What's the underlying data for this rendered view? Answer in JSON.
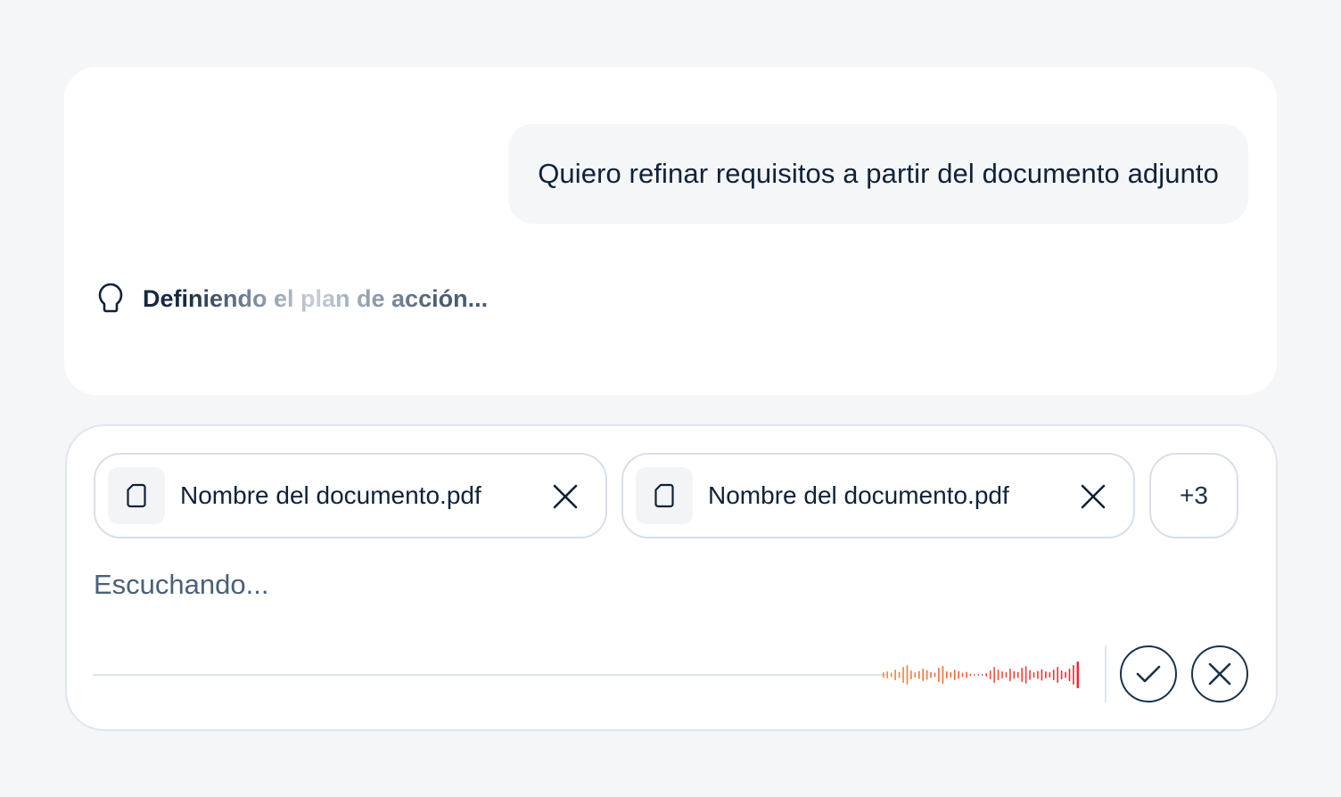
{
  "chat": {
    "user_message": "Quiero refinar requisitos a partir del documento adjunto",
    "status_icon": "lightbulb-icon",
    "status_text": "Definiendo el plan de acción..."
  },
  "composer": {
    "attachments": [
      {
        "name": "Nombre del documento.pdf",
        "icon": "file-icon",
        "remove_icon": "close-icon"
      },
      {
        "name": "Nombre del documento.pdf",
        "icon": "file-icon",
        "remove_icon": "close-icon"
      }
    ],
    "more_count": "+3",
    "listening_text": "Escuchando...",
    "confirm_icon": "check-icon",
    "cancel_icon": "close-icon"
  },
  "colors": {
    "page_background": "#f5f6f8",
    "panel_background": "#ffffff",
    "text_primary": "#0f2238",
    "waveform_start": "#f08a3c",
    "waveform_end": "#e8253f"
  }
}
